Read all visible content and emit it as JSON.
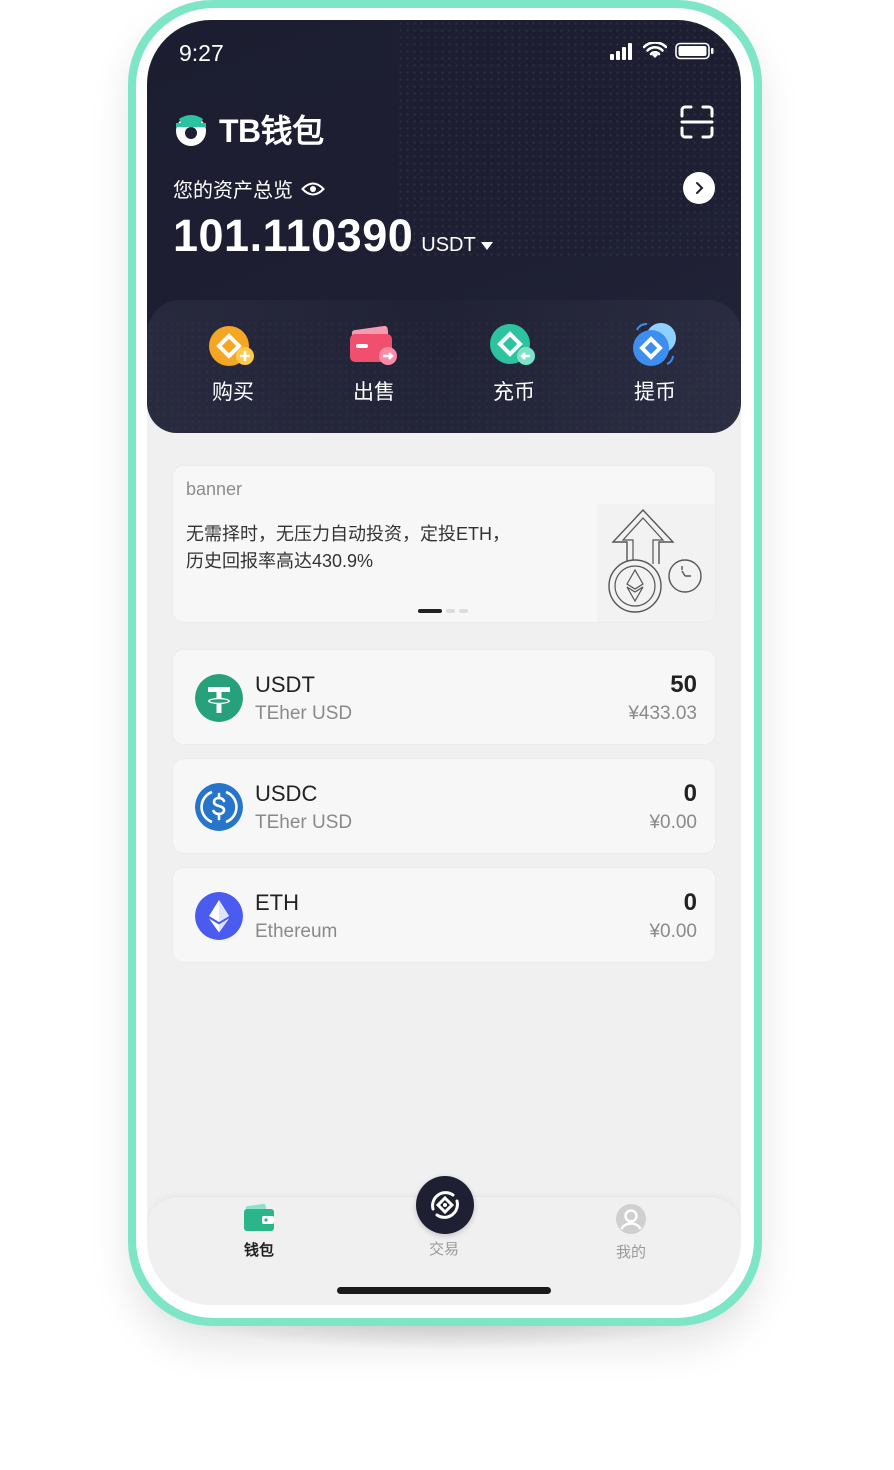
{
  "status_bar": {
    "time": "9:27"
  },
  "header": {
    "brand_name": "TB钱包",
    "overview_label": "您的资产总览",
    "balance": "101.110390",
    "balance_unit": "USDT"
  },
  "actions": [
    {
      "label": "购买",
      "icon": "buy-icon",
      "color": "#f5a623"
    },
    {
      "label": "出售",
      "icon": "sell-icon",
      "color": "#f0506e"
    },
    {
      "label": "充币",
      "icon": "deposit-icon",
      "color": "#2bc3a0"
    },
    {
      "label": "提币",
      "icon": "withdraw-icon",
      "color": "#3d8ef0"
    }
  ],
  "banner": {
    "tag": "banner",
    "line1": "无需择时，无压力自动投资，定投ETH，",
    "line2": "历史回报率高达430.9%"
  },
  "coins": [
    {
      "symbol": "USDT",
      "name": "TEher USD",
      "amount": "50",
      "fiat": "¥433.03",
      "icon": "usdt-icon",
      "color": "#26a17b"
    },
    {
      "symbol": "USDC",
      "name": "TEher USD",
      "amount": "0",
      "fiat": "¥0.00",
      "icon": "usdc-icon",
      "color": "#2775ca"
    },
    {
      "symbol": "ETH",
      "name": "Ethereum",
      "amount": "0",
      "fiat": "¥0.00",
      "icon": "eth-icon",
      "color": "#4a5cf0"
    }
  ],
  "tabbar": {
    "wallet": "钱包",
    "trade": "交易",
    "mine": "我的",
    "active_color": "#2bb58a",
    "inactive_color": "#9a9a9a"
  }
}
